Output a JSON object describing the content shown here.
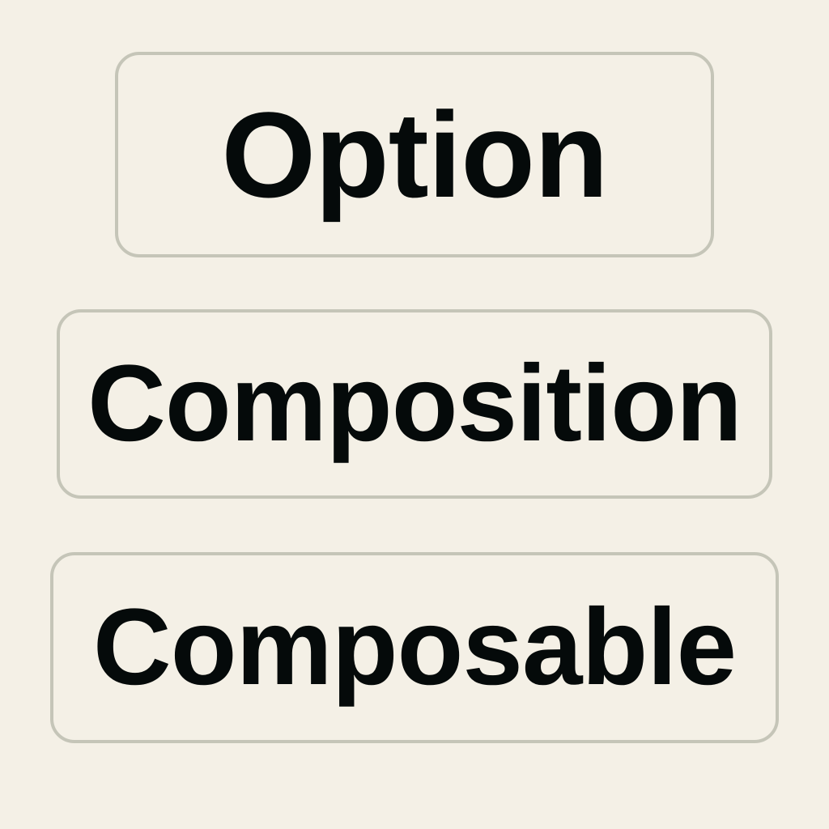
{
  "options": [
    {
      "label": "Option"
    },
    {
      "label": "Composition"
    },
    {
      "label": "Composable"
    }
  ],
  "colors": {
    "background": "#f4f0e6",
    "border": "#c5c5b8",
    "text": "#050a0a"
  }
}
